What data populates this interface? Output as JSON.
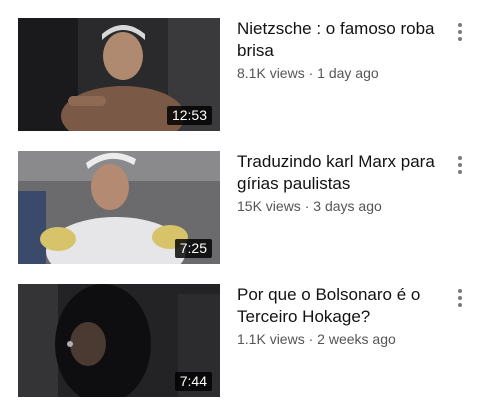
{
  "videos": [
    {
      "title": "Nietzsche : o famoso roba brisa",
      "views": "8.1K views",
      "separator": "·",
      "age": "1 day ago",
      "duration": "12:53",
      "menu_icon": "more-vert-icon"
    },
    {
      "title": "Traduzindo karl Marx para gírias paulistas",
      "views": "15K views",
      "separator": "·",
      "age": "3 days ago",
      "duration": "7:25",
      "menu_icon": "more-vert-icon"
    },
    {
      "title": "Por que o Bolsonaro é o Terceiro Hokage?",
      "views": "1.1K views",
      "separator": "·",
      "age": "2 weeks ago",
      "duration": "7:44",
      "menu_icon": "more-vert-icon"
    }
  ],
  "colors": {
    "background": "#ffffff",
    "title_text": "#121212",
    "meta_text": "#555555",
    "duration_badge": "#000000",
    "menu_dots": "#7a7a7a"
  }
}
